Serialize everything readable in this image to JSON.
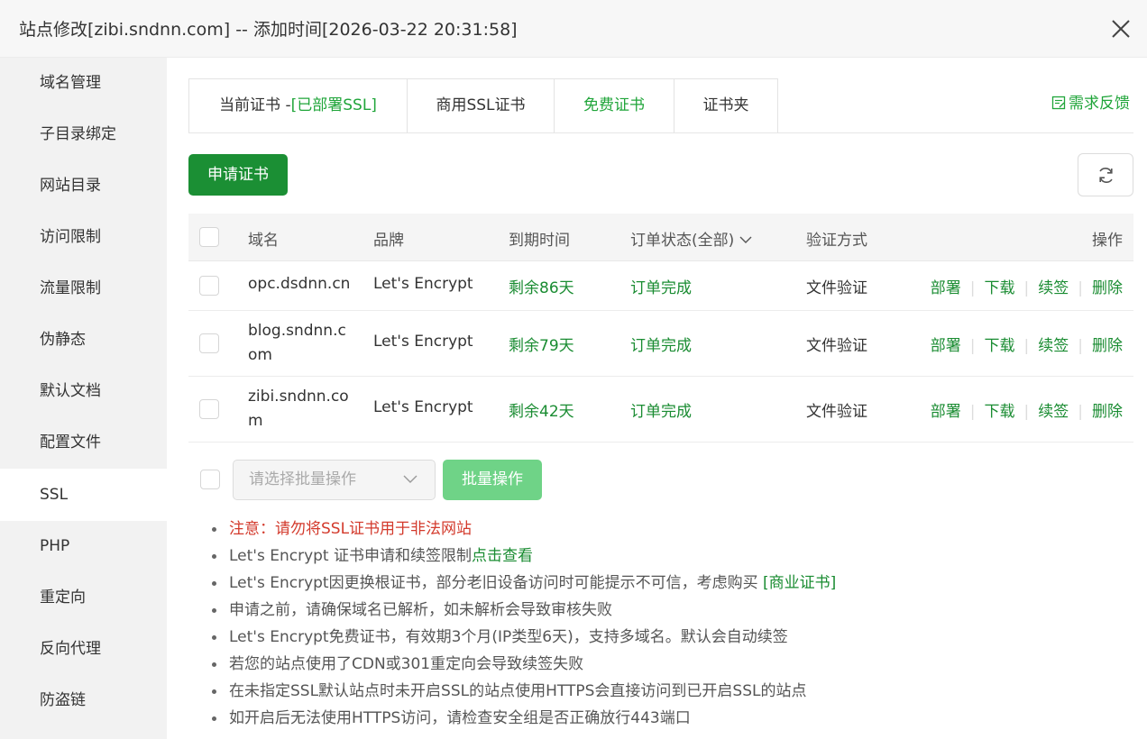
{
  "dialog": {
    "title": "站点修改[zibi.sndnn.com] -- 添加时间[2026-03-22 20:31:58]"
  },
  "sidebar": {
    "items": [
      {
        "label": "域名管理",
        "active": false
      },
      {
        "label": "子目录绑定",
        "active": false
      },
      {
        "label": "网站目录",
        "active": false
      },
      {
        "label": "访问限制",
        "active": false
      },
      {
        "label": "流量限制",
        "active": false
      },
      {
        "label": "伪静态",
        "active": false
      },
      {
        "label": "默认文档",
        "active": false
      },
      {
        "label": "配置文件",
        "active": false
      },
      {
        "label": "SSL",
        "active": true
      },
      {
        "label": "PHP",
        "active": false
      },
      {
        "label": "重定向",
        "active": false
      },
      {
        "label": "反向代理",
        "active": false
      },
      {
        "label": "防盗链",
        "active": false
      }
    ]
  },
  "tabs": {
    "current_prefix": "当前证书 -",
    "current_status": "[已部署SSL]",
    "commercial": "商用SSL证书",
    "free": "免费证书",
    "folder": "证书夹",
    "active": "free"
  },
  "feedback_label": "需求反馈",
  "actions": {
    "apply_label": "申请证书"
  },
  "table": {
    "headers": {
      "domain": "域名",
      "brand": "品牌",
      "expiry": "到期时间",
      "status": "订单状态(全部)",
      "verify": "验证方式",
      "ops": "操作"
    },
    "rows": [
      {
        "domain": "opc.dsdnn.cn",
        "brand": "Let's Encrypt",
        "expiry": "剩余86天",
        "status": "订单完成",
        "verify": "文件验证"
      },
      {
        "domain": "blog.sndnn.com",
        "brand": "Let's Encrypt",
        "expiry": "剩余79天",
        "status": "订单完成",
        "verify": "文件验证"
      },
      {
        "domain": "zibi.sndnn.com",
        "brand": "Let's Encrypt",
        "expiry": "剩余42天",
        "status": "订单完成",
        "verify": "文件验证"
      }
    ],
    "row_ops": {
      "deploy": "部署",
      "download": "下载",
      "renew": "续签",
      "delete": "删除"
    }
  },
  "batch": {
    "placeholder": "请选择批量操作",
    "button": "批量操作"
  },
  "notes": {
    "n1": "注意：请勿将SSL证书用于非法网站",
    "n2_text": "Let's Encrypt 证书申请和续签限制",
    "n2_link": "点击查看",
    "n3_text": "Let's Encrypt因更换根证书，部分老旧设备访问时可能提示不可信，考虑购买 ",
    "n3_link": "[商业证书]",
    "n4": "申请之前，请确保域名已解析，如未解析会导致审核失败",
    "n5": "Let's Encrypt免费证书，有效期3个月(IP类型6天)，支持多域名。默认会自动续签",
    "n6": "若您的站点使用了CDN或301重定向会导致续签失败",
    "n7": "在未指定SSL默认站点时未开启SSL的站点使用HTTPS会直接访问到已开启SSL的站点",
    "n8": "如开启后无法使用HTTPS访问，请检查安全组是否正确放行443端口"
  },
  "colors": {
    "accent": "#20a53a",
    "primary_button": "#1b8f34",
    "disabled_button": "#6fd387",
    "warning": "#d33a2c",
    "sidebar_bg": "#f2f2f2"
  }
}
